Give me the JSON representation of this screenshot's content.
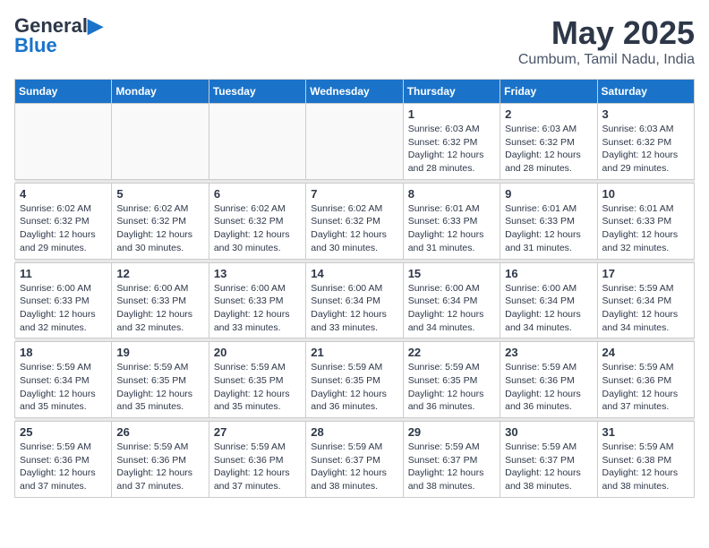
{
  "logo": {
    "line1": "General",
    "line2": "Blue",
    "arrow": "▶"
  },
  "title": {
    "month_year": "May 2025",
    "location": "Cumbum, Tamil Nadu, India"
  },
  "weekdays": [
    "Sunday",
    "Monday",
    "Tuesday",
    "Wednesday",
    "Thursday",
    "Friday",
    "Saturday"
  ],
  "weeks": [
    [
      {
        "day": "",
        "detail": ""
      },
      {
        "day": "",
        "detail": ""
      },
      {
        "day": "",
        "detail": ""
      },
      {
        "day": "",
        "detail": ""
      },
      {
        "day": "1",
        "detail": "Sunrise: 6:03 AM\nSunset: 6:32 PM\nDaylight: 12 hours\nand 28 minutes."
      },
      {
        "day": "2",
        "detail": "Sunrise: 6:03 AM\nSunset: 6:32 PM\nDaylight: 12 hours\nand 28 minutes."
      },
      {
        "day": "3",
        "detail": "Sunrise: 6:03 AM\nSunset: 6:32 PM\nDaylight: 12 hours\nand 29 minutes."
      }
    ],
    [
      {
        "day": "4",
        "detail": "Sunrise: 6:02 AM\nSunset: 6:32 PM\nDaylight: 12 hours\nand 29 minutes."
      },
      {
        "day": "5",
        "detail": "Sunrise: 6:02 AM\nSunset: 6:32 PM\nDaylight: 12 hours\nand 30 minutes."
      },
      {
        "day": "6",
        "detail": "Sunrise: 6:02 AM\nSunset: 6:32 PM\nDaylight: 12 hours\nand 30 minutes."
      },
      {
        "day": "7",
        "detail": "Sunrise: 6:02 AM\nSunset: 6:32 PM\nDaylight: 12 hours\nand 30 minutes."
      },
      {
        "day": "8",
        "detail": "Sunrise: 6:01 AM\nSunset: 6:33 PM\nDaylight: 12 hours\nand 31 minutes."
      },
      {
        "day": "9",
        "detail": "Sunrise: 6:01 AM\nSunset: 6:33 PM\nDaylight: 12 hours\nand 31 minutes."
      },
      {
        "day": "10",
        "detail": "Sunrise: 6:01 AM\nSunset: 6:33 PM\nDaylight: 12 hours\nand 32 minutes."
      }
    ],
    [
      {
        "day": "11",
        "detail": "Sunrise: 6:00 AM\nSunset: 6:33 PM\nDaylight: 12 hours\nand 32 minutes."
      },
      {
        "day": "12",
        "detail": "Sunrise: 6:00 AM\nSunset: 6:33 PM\nDaylight: 12 hours\nand 32 minutes."
      },
      {
        "day": "13",
        "detail": "Sunrise: 6:00 AM\nSunset: 6:33 PM\nDaylight: 12 hours\nand 33 minutes."
      },
      {
        "day": "14",
        "detail": "Sunrise: 6:00 AM\nSunset: 6:34 PM\nDaylight: 12 hours\nand 33 minutes."
      },
      {
        "day": "15",
        "detail": "Sunrise: 6:00 AM\nSunset: 6:34 PM\nDaylight: 12 hours\nand 34 minutes."
      },
      {
        "day": "16",
        "detail": "Sunrise: 6:00 AM\nSunset: 6:34 PM\nDaylight: 12 hours\nand 34 minutes."
      },
      {
        "day": "17",
        "detail": "Sunrise: 5:59 AM\nSunset: 6:34 PM\nDaylight: 12 hours\nand 34 minutes."
      }
    ],
    [
      {
        "day": "18",
        "detail": "Sunrise: 5:59 AM\nSunset: 6:34 PM\nDaylight: 12 hours\nand 35 minutes."
      },
      {
        "day": "19",
        "detail": "Sunrise: 5:59 AM\nSunset: 6:35 PM\nDaylight: 12 hours\nand 35 minutes."
      },
      {
        "day": "20",
        "detail": "Sunrise: 5:59 AM\nSunset: 6:35 PM\nDaylight: 12 hours\nand 35 minutes."
      },
      {
        "day": "21",
        "detail": "Sunrise: 5:59 AM\nSunset: 6:35 PM\nDaylight: 12 hours\nand 36 minutes."
      },
      {
        "day": "22",
        "detail": "Sunrise: 5:59 AM\nSunset: 6:35 PM\nDaylight: 12 hours\nand 36 minutes."
      },
      {
        "day": "23",
        "detail": "Sunrise: 5:59 AM\nSunset: 6:36 PM\nDaylight: 12 hours\nand 36 minutes."
      },
      {
        "day": "24",
        "detail": "Sunrise: 5:59 AM\nSunset: 6:36 PM\nDaylight: 12 hours\nand 37 minutes."
      }
    ],
    [
      {
        "day": "25",
        "detail": "Sunrise: 5:59 AM\nSunset: 6:36 PM\nDaylight: 12 hours\nand 37 minutes."
      },
      {
        "day": "26",
        "detail": "Sunrise: 5:59 AM\nSunset: 6:36 PM\nDaylight: 12 hours\nand 37 minutes."
      },
      {
        "day": "27",
        "detail": "Sunrise: 5:59 AM\nSunset: 6:36 PM\nDaylight: 12 hours\nand 37 minutes."
      },
      {
        "day": "28",
        "detail": "Sunrise: 5:59 AM\nSunset: 6:37 PM\nDaylight: 12 hours\nand 38 minutes."
      },
      {
        "day": "29",
        "detail": "Sunrise: 5:59 AM\nSunset: 6:37 PM\nDaylight: 12 hours\nand 38 minutes."
      },
      {
        "day": "30",
        "detail": "Sunrise: 5:59 AM\nSunset: 6:37 PM\nDaylight: 12 hours\nand 38 minutes."
      },
      {
        "day": "31",
        "detail": "Sunrise: 5:59 AM\nSunset: 6:38 PM\nDaylight: 12 hours\nand 38 minutes."
      }
    ]
  ]
}
